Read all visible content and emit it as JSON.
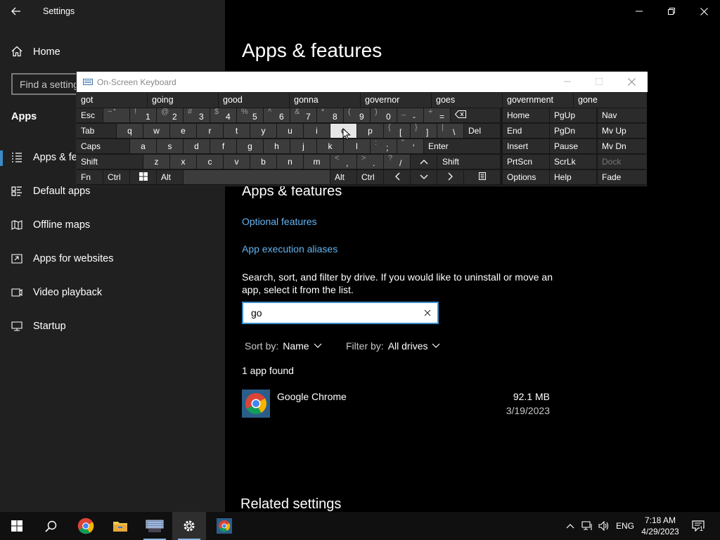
{
  "window": {
    "title": "Settings"
  },
  "sidebar": {
    "home_label": "Home",
    "search_placeholder": "Find a setting",
    "section": "Apps",
    "items": [
      {
        "label": "Apps & features",
        "icon": "list-icon"
      },
      {
        "label": "Default apps",
        "icon": "default-apps-icon"
      },
      {
        "label": "Offline maps",
        "icon": "map-icon"
      },
      {
        "label": "Apps for websites",
        "icon": "website-icon"
      },
      {
        "label": "Video playback",
        "icon": "video-icon"
      },
      {
        "label": "Startup",
        "icon": "startup-icon"
      }
    ]
  },
  "main": {
    "page_title": "Apps & features",
    "sub_title": "Apps & features",
    "links": [
      "Optional features",
      "App execution aliases"
    ],
    "description": "Search, sort, and filter by drive. If you would like to uninstall or move an app, select it from the list.",
    "search_value": "go",
    "sort_label": "Sort by:",
    "sort_value": "Name",
    "filter_label": "Filter by:",
    "filter_value": "All drives",
    "count_text": "1 app found",
    "apps": [
      {
        "name": "Google Chrome",
        "size": "92.1 MB",
        "date": "3/19/2023"
      }
    ],
    "related_title": "Related settings"
  },
  "osk": {
    "title": "On-Screen Keyboard",
    "predictions": [
      "got",
      "going",
      "good",
      "gonna",
      "governor",
      "goes",
      "government",
      "gone"
    ],
    "rows": {
      "row1_left": "Esc",
      "num_keys": [
        {
          "shift": "~",
          "main": "`"
        },
        {
          "shift": "!",
          "main": "1"
        },
        {
          "shift": "@",
          "main": "2"
        },
        {
          "shift": "#",
          "main": "3"
        },
        {
          "shift": "$",
          "main": "4"
        },
        {
          "shift": "%",
          "main": "5"
        },
        {
          "shift": "^",
          "main": "6"
        },
        {
          "shift": "&",
          "main": "7"
        },
        {
          "shift": "*",
          "main": "8"
        },
        {
          "shift": "(",
          "main": "9"
        },
        {
          "shift": ")",
          "main": "0"
        },
        {
          "shift": "_",
          "main": "-"
        },
        {
          "shift": "+",
          "main": "="
        }
      ],
      "row2": [
        "Tab",
        "q",
        "w",
        "e",
        "r",
        "t",
        "y",
        "u",
        "i",
        "o",
        "p"
      ],
      "row2_sym": [
        {
          "shift": "{",
          "main": "["
        },
        {
          "shift": "}",
          "main": "]"
        },
        {
          "shift": "|",
          "main": "\\"
        }
      ],
      "del": "Del",
      "row3": [
        "Caps",
        "a",
        "s",
        "d",
        "f",
        "g",
        "h",
        "j",
        "k",
        "l"
      ],
      "row3_sym": [
        {
          "shift": ":",
          "main": ";"
        },
        {
          "shift": "\"",
          "main": "'"
        }
      ],
      "enter": "Enter",
      "row4": [
        "Shift",
        "z",
        "x",
        "c",
        "v",
        "b",
        "n",
        "m"
      ],
      "row4_sym": [
        {
          "shift": "<",
          "main": ","
        },
        {
          "shift": ">",
          "main": "."
        },
        {
          "shift": "?",
          "main": "/"
        }
      ],
      "shift_r": "Shift",
      "row5": [
        "Fn",
        "Ctrl",
        "Alt",
        "Alt",
        "Ctrl"
      ],
      "nav_col1": [
        "Home",
        "End",
        "Insert",
        "PrtScn",
        "Options"
      ],
      "nav_col2": [
        "PgUp",
        "PgDn",
        "Pause",
        "ScrLk",
        "Help"
      ],
      "nav_col3": [
        "Nav",
        "Mv Up",
        "Mv Dn",
        "Dock",
        "Fade"
      ]
    }
  },
  "taskbar": {
    "language": "ENG",
    "time": "7:18 AM",
    "date": "4/29/2023",
    "notification_count": "1"
  },
  "colors": {
    "accent": "#3a8cc8",
    "link": "#64b4f0",
    "sidebar_bg": "#202020"
  }
}
